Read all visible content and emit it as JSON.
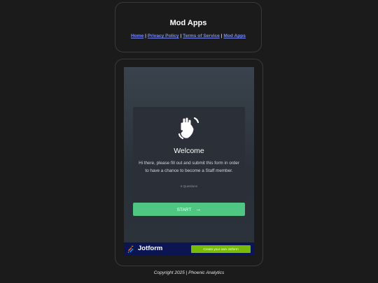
{
  "header": {
    "title": "Mod Apps",
    "nav": {
      "home": "Home",
      "privacy": "Privacy Policy",
      "terms": "Terms of Service",
      "mod_apps": "Mod Apps",
      "separator": "|"
    }
  },
  "form": {
    "icon": "waving-hand-icon",
    "title": "Welcome",
    "description": "Hi there, please fill out and submit this form in order to have a chance to become a Staff member.",
    "question_count": "6 Questions",
    "start_label": "START",
    "start_arrow": "→",
    "colors": {
      "start_button": "#4fc783",
      "panel": "#2a2f38"
    }
  },
  "jotform_bar": {
    "brand": "Jotform",
    "cta_label": "Create your own Jotform",
    "colors": {
      "bar": "#0a1551",
      "cta": "#78bb07"
    }
  },
  "footer": {
    "text": "Copyright 2025 | Phoenic Analytics"
  }
}
